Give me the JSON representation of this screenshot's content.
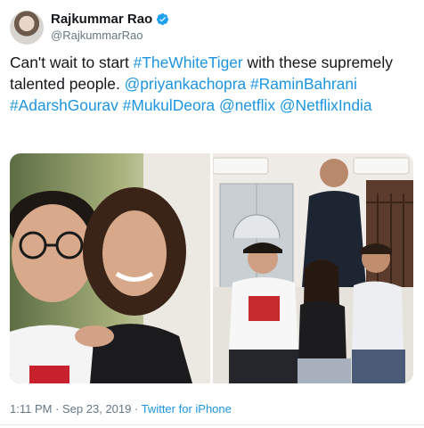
{
  "user": {
    "display_name": "Rajkummar Rao",
    "handle": "@RajkummarRao"
  },
  "tweet": {
    "segments": [
      {
        "text": "Can't wait to start ",
        "link": false
      },
      {
        "text": "#TheWhiteTiger",
        "link": true
      },
      {
        "text": " with these supremely talented people. ",
        "link": false
      },
      {
        "text": "@priyankachopra",
        "link": true
      },
      {
        "text": " ",
        "link": false
      },
      {
        "text": "#RaminBahrani",
        "link": true
      },
      {
        "text": " ",
        "link": false
      },
      {
        "text": "#AdarshGourav",
        "link": true
      },
      {
        "text": " ",
        "link": false
      },
      {
        "text": "#MukulDeora",
        "link": true
      },
      {
        "text": " ",
        "link": false
      },
      {
        "text": "@netflix",
        "link": true
      },
      {
        "text": " ",
        "link": false
      },
      {
        "text": "@NetflixIndia",
        "link": true
      }
    ]
  },
  "meta": {
    "time": "1:11 PM",
    "sep": " · ",
    "date": "Sep 23, 2019",
    "sep2": " · ",
    "source": "Twitter for iPhone"
  },
  "colors": {
    "link": "#1b95e0",
    "verified": "#1da1f2",
    "muted": "#657786"
  }
}
